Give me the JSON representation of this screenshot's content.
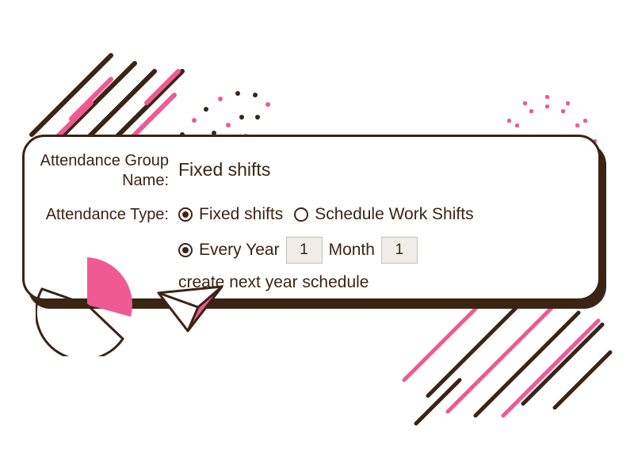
{
  "labels": {
    "group_name": "Attendance Group Name:",
    "type": "Attendance Type:"
  },
  "fields": {
    "group_name_value": "Fixed shifts",
    "type_options": {
      "fixed": "Fixed shifts",
      "scheduled": "Schedule Work Shifts"
    },
    "schedule_sentence": {
      "every_year": "Every Year",
      "month_value": "1",
      "month_label": "Month",
      "day_value": "1",
      "tail": "create next year schedule"
    }
  },
  "colors": {
    "brown": "#3a2416",
    "pink": "#ef5a93"
  }
}
